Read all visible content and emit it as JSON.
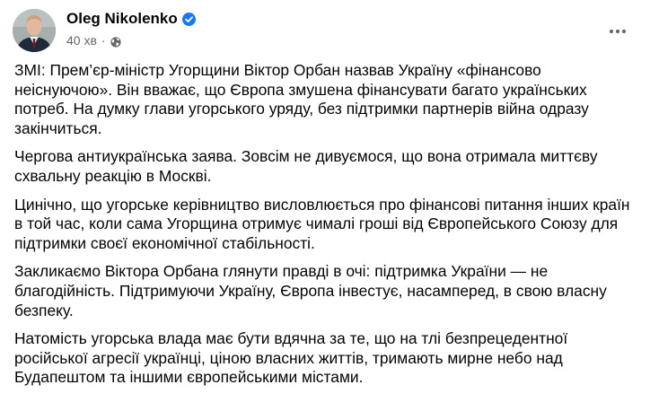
{
  "post": {
    "author": {
      "name": "Oleg Nikolenko",
      "verified": true
    },
    "timestamp": "40 хв",
    "separator": "·",
    "audience_icon": "globe-icon",
    "more_icon": "more-horizontal-icon",
    "verified_color": "#1877f2",
    "paragraphs": [
      "ЗМІ: Прем’єр-міністр Угорщини Віктор Орбан назвав Україну «фінансово неіснуючою». Він вважає, що Європа змушена фінансувати багато українських потреб. На думку глави угорського уряду, без підтримки партнерів війна одразу закінчиться.",
      "Чергова антиукраїнська заява. Зовсім не дивуємося, що вона отримала миттєву схвальну реакцію в Москві.",
      "Цинічно, що угорське керівництво висловлюється про фінансові питання інших країн в той час, коли сама Угорщина отримує чималі гроші від Європейського Союзу для підтримки своєї економічної стабільності.",
      "Закликаємо Віктора Орбана глянути правді в очі: підтримка України — не благодійність. Підтримуючи Україну, Європа інвестує, насамперед, в свою власну безпеку.",
      "Натомість угорська влада має бути вдячна за те, що на тлі безпрецедентної російської агресії українці, ціною власних життів, тримають мирне небо над Будапештом та іншими європейськими містами."
    ]
  }
}
